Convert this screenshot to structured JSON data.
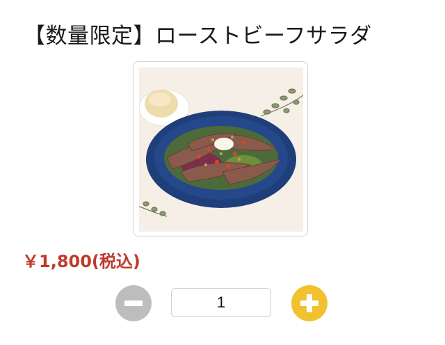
{
  "product": {
    "title": "【数量限定】ローストビーフサラダ",
    "image_alt": "ローストビーフサラダ",
    "price": "￥1,800(税込)"
  },
  "quantity": {
    "value": "1",
    "minus_icon": "minus-circle-icon",
    "plus_icon": "plus-circle-icon"
  },
  "colors": {
    "price": "#c0392b",
    "minus_button": "#bdbdbd",
    "plus_button": "#f2c12e",
    "plate": "#1f3f7a"
  }
}
